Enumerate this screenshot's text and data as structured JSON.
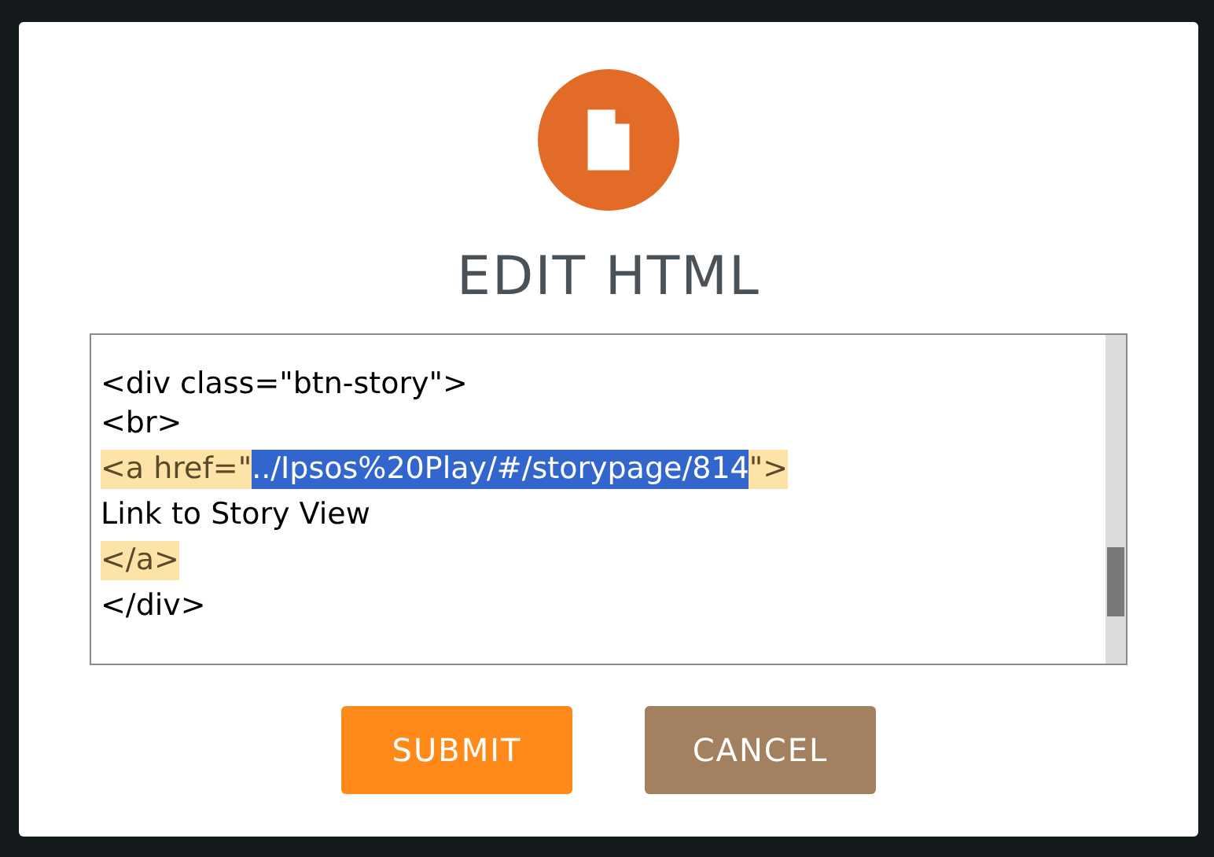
{
  "dialog": {
    "title": "EDIT HTML"
  },
  "editor": {
    "lines": [
      {
        "segments": [
          {
            "text": "<div class=\"btn-story\">",
            "matched": false,
            "selected": false
          }
        ]
      },
      {
        "segments": [
          {
            "text": "<br>",
            "matched": false,
            "selected": false
          }
        ]
      },
      {
        "segments": [
          {
            "text": "<a href=\"",
            "matched": true,
            "selected": false
          },
          {
            "text": "../Ipsos%20Play/#/storypage/814",
            "selected": true
          },
          {
            "text": "\">",
            "matched": true,
            "selected": false
          }
        ]
      },
      {
        "segments": [
          {
            "text": "Link to Story View",
            "matched": false,
            "selected": false
          }
        ]
      },
      {
        "segments": [
          {
            "text": "</a>",
            "matched": true,
            "selected": false
          }
        ]
      },
      {
        "segments": [
          {
            "text": "</div>",
            "matched": false,
            "selected": false
          }
        ]
      }
    ]
  },
  "buttons": [
    {
      "label": "SUBMIT",
      "kind": "primary"
    },
    {
      "label": "CANCEL",
      "kind": "secondary"
    }
  ]
}
